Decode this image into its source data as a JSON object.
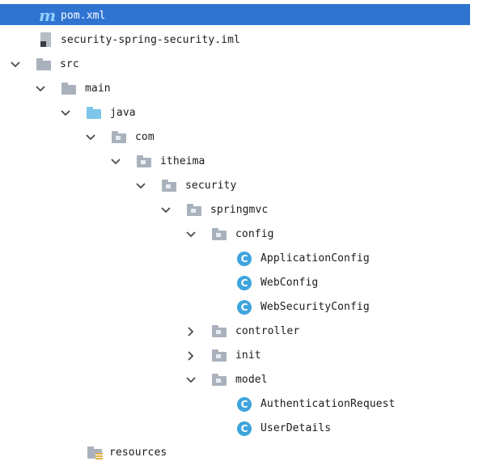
{
  "project_tree": {
    "items": [
      {
        "label": "pom.xml",
        "icon": "maven-icon",
        "depth": 0,
        "expandable": false,
        "selected": true
      },
      {
        "label": "security-spring-security.iml",
        "icon": "iml-file-icon",
        "depth": 0,
        "expandable": false
      },
      {
        "label": "src",
        "icon": "folder-icon",
        "depth": 0,
        "expandable": true,
        "expanded": true
      },
      {
        "label": "main",
        "icon": "folder-icon",
        "depth": 1,
        "expandable": true,
        "expanded": true
      },
      {
        "label": "java",
        "icon": "source-root-folder-icon",
        "depth": 2,
        "expandable": true,
        "expanded": true
      },
      {
        "label": "com",
        "icon": "package-icon",
        "depth": 3,
        "expandable": true,
        "expanded": true
      },
      {
        "label": "itheima",
        "icon": "package-icon",
        "depth": 4,
        "expandable": true,
        "expanded": true
      },
      {
        "label": "security",
        "icon": "package-icon",
        "depth": 5,
        "expandable": true,
        "expanded": true
      },
      {
        "label": "springmvc",
        "icon": "package-icon",
        "depth": 6,
        "expandable": true,
        "expanded": true
      },
      {
        "label": "config",
        "icon": "package-icon",
        "depth": 7,
        "expandable": true,
        "expanded": true
      },
      {
        "label": "ApplicationConfig",
        "icon": "class-icon",
        "depth": 8,
        "expandable": false
      },
      {
        "label": "WebConfig",
        "icon": "class-icon",
        "depth": 8,
        "expandable": false
      },
      {
        "label": "WebSecurityConfig",
        "icon": "class-icon",
        "depth": 8,
        "expandable": false
      },
      {
        "label": "controller",
        "icon": "package-icon",
        "depth": 7,
        "expandable": true,
        "expanded": false
      },
      {
        "label": "init",
        "icon": "package-icon",
        "depth": 7,
        "expandable": true,
        "expanded": false
      },
      {
        "label": "model",
        "icon": "package-icon",
        "depth": 7,
        "expandable": true,
        "expanded": true
      },
      {
        "label": "AuthenticationRequest",
        "icon": "class-icon",
        "depth": 8,
        "expandable": false
      },
      {
        "label": "UserDetails",
        "icon": "class-icon",
        "depth": 8,
        "expandable": false
      },
      {
        "label": "resources",
        "icon": "resources-folder-icon",
        "depth": 2,
        "expandable": false
      }
    ]
  },
  "icon_glyphs": {
    "class": "C",
    "maven": "m"
  },
  "colors": {
    "selection": "#2f74d0",
    "class_icon": "#3ea4dd",
    "source_root_folder": "#7ec6ea",
    "folder": "#a9b2bc"
  }
}
